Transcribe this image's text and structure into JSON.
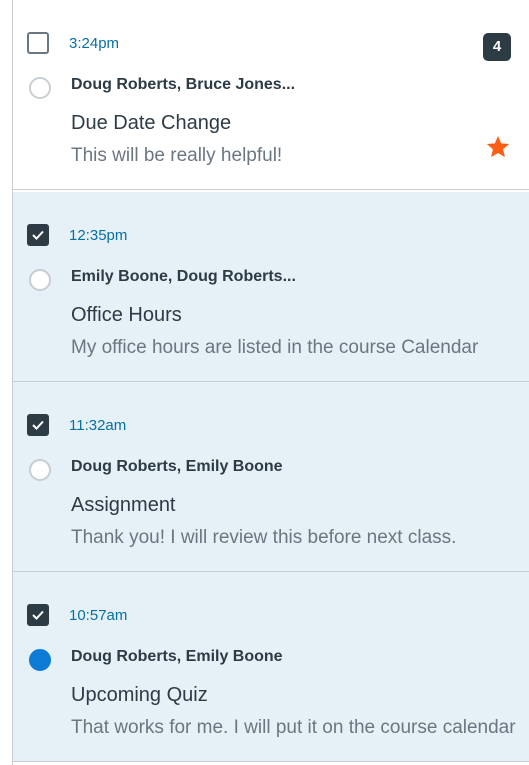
{
  "colors": {
    "accent_blue": "#0770a3",
    "unread_dot": "#0b7bd6",
    "selected_bg": "#e5f0f7",
    "dark": "#2d3b45",
    "muted": "#6b7780",
    "star": "#fc5e13"
  },
  "messages": [
    {
      "checked": false,
      "time": "3:24pm",
      "participants": "Doug Roberts, Bruce Jones...",
      "subject": "Due Date Change",
      "preview": "This will be really helpful!",
      "count": "4",
      "starred": true,
      "unread": false
    },
    {
      "checked": true,
      "time": "12:35pm",
      "participants": "Emily Boone, Doug Roberts...",
      "subject": "Office Hours",
      "preview": "My office hours are listed in the course Calendar",
      "unread": false
    },
    {
      "checked": true,
      "time": "11:32am",
      "participants": "Doug Roberts, Emily Boone",
      "subject": "Assignment",
      "preview": "Thank you! I will review this before next class.",
      "unread": false
    },
    {
      "checked": true,
      "time": "10:57am",
      "participants": "Doug Roberts, Emily Boone",
      "subject": "Upcoming Quiz",
      "preview": "That works for me. I will put it on the course calendar",
      "unread": true
    }
  ]
}
